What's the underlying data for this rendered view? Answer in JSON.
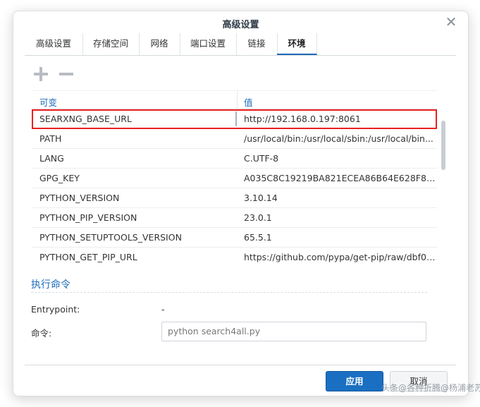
{
  "dialog": {
    "title": "高级设置",
    "close_icon": "close-icon"
  },
  "tabs": [
    {
      "label": "高级设置",
      "active": false
    },
    {
      "label": "存储空间",
      "active": false
    },
    {
      "label": "网络",
      "active": false
    },
    {
      "label": "端口设置",
      "active": false
    },
    {
      "label": "链接",
      "active": false
    },
    {
      "label": "环境",
      "active": true
    }
  ],
  "toolbar": {
    "add_icon": "plus-icon",
    "remove_icon": "minus-icon"
  },
  "env_table": {
    "headers": {
      "key": "可变",
      "value": "值"
    },
    "rows": [
      {
        "key": "SEARXNG_BASE_URL",
        "value": "http://192.168.0.197:8061",
        "selected": true
      },
      {
        "key": "PATH",
        "value": "/usr/local/bin:/usr/local/sbin:/usr/local/bin..."
      },
      {
        "key": "LANG",
        "value": "C.UTF-8"
      },
      {
        "key": "GPG_KEY",
        "value": "A035C8C19219BA821ECEA86B64E628F8D..."
      },
      {
        "key": "PYTHON_VERSION",
        "value": "3.10.14"
      },
      {
        "key": "PYTHON_PIP_VERSION",
        "value": "23.0.1"
      },
      {
        "key": "PYTHON_SETUPTOOLS_VERSION",
        "value": "65.5.1"
      },
      {
        "key": "PYTHON_GET_PIP_URL",
        "value": "https://github.com/pypa/get-pip/raw/dbf0c..."
      }
    ],
    "highlight_color": "#e8201f"
  },
  "exec": {
    "section_title": "执行命令",
    "entrypoint_label": "Entrypoint:",
    "entrypoint_value": "-",
    "command_label": "命令:",
    "command_value": "python search4all.py"
  },
  "footer": {
    "apply_label": "应用",
    "cancel_label": "取消"
  },
  "watermark": "头条@各种折腾@杨浦老苏",
  "colors": {
    "accent": "#1d6bb8",
    "apply_button": "#1a6fc2"
  }
}
